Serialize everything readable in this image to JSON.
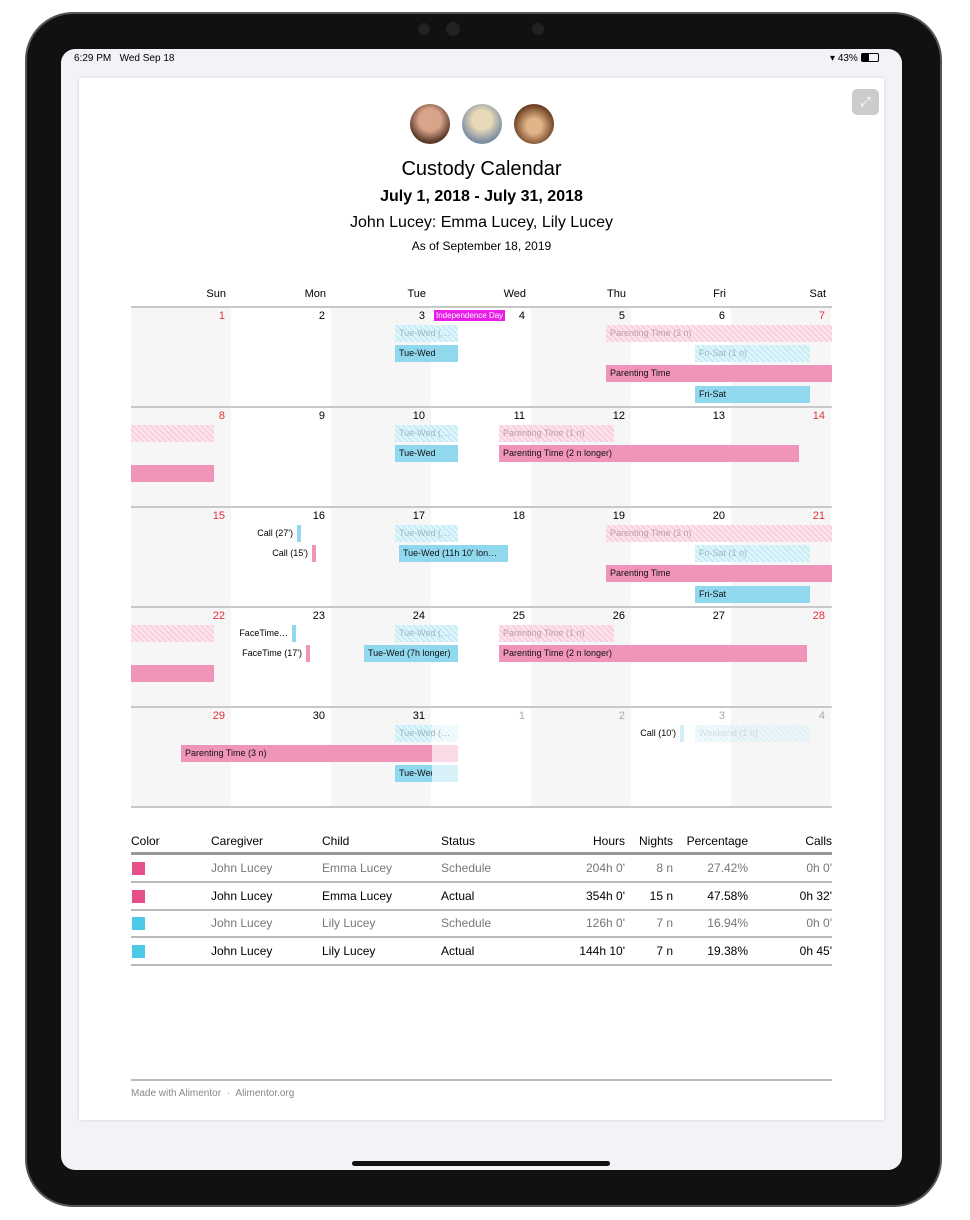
{
  "status_bar": {
    "time": "6:29 PM",
    "date": "Wed Sep 18",
    "battery": "43%"
  },
  "header": {
    "title": "Custody Calendar",
    "date_range": "July 1, 2018 - July 31, 2018",
    "family": "John Lucey: Emma Lucey, Lily Lucey",
    "as_of": "As of September 18, 2019"
  },
  "colors": {
    "parent_pink": "#f095b9",
    "child_blue": "#8fd8ee",
    "holiday": "#e81ee8",
    "weekend_red": "#e0333b",
    "swatch_pink": "#e6508a",
    "swatch_blue": "#4dc8e6"
  },
  "calendar": {
    "days": [
      "Sun",
      "Mon",
      "Tue",
      "Wed",
      "Thu",
      "Fri",
      "Sat"
    ],
    "weeks": [
      {
        "dates": [
          "1",
          "2",
          "3",
          "4",
          "5",
          "6",
          "7"
        ],
        "events": [
          "Independence Day",
          "Tue-Wed (…",
          "Tue-Wed",
          "Parenting Time (3 n)",
          "Fri-Sat (1 n)",
          "Parenting Time",
          "Fri-Sat"
        ]
      },
      {
        "dates": [
          "8",
          "9",
          "10",
          "11",
          "12",
          "13",
          "14"
        ],
        "events": [
          "Tue-Wed (…",
          "Tue-Wed",
          "Parenting Time (1 n)",
          "Parenting Time (2 n longer)"
        ]
      },
      {
        "dates": [
          "15",
          "16",
          "17",
          "18",
          "19",
          "20",
          "21"
        ],
        "events": [
          "Call (27')",
          "Call (15')",
          "Tue-Wed (…",
          "Tue-Wed (11h 10' lon…",
          "Parenting Time (3 n)",
          "Fri-Sat (1 n)",
          "Parenting Time",
          "Fri-Sat"
        ]
      },
      {
        "dates": [
          "22",
          "23",
          "24",
          "25",
          "26",
          "27",
          "28"
        ],
        "events": [
          "FaceTime…",
          "FaceTime (17')",
          "Tue-Wed (…",
          "Tue-Wed (7h longer)",
          "Parenting Time (1 n)",
          "Parenting Time (2 n longer)"
        ]
      },
      {
        "dates": [
          "29",
          "30",
          "31",
          "1",
          "2",
          "3",
          "4"
        ],
        "events": [
          "Tue-Wed (…",
          "Parenting Time (3 n)",
          "Tue-Wed",
          "Call (10')",
          "Weekend (1 n)"
        ]
      }
    ]
  },
  "summary": {
    "headers": [
      "Color",
      "Caregiver",
      "Child",
      "Status",
      "Hours",
      "Nights",
      "Percentage",
      "Calls"
    ],
    "rows": [
      {
        "color": "pink",
        "caregiver": "John Lucey",
        "child": "Emma Lucey",
        "status": "Schedule",
        "hours": "204h 0'",
        "nights": "8 n",
        "percentage": "27.42%",
        "calls": "0h 0'"
      },
      {
        "color": "pink",
        "caregiver": "John Lucey",
        "child": "Emma Lucey",
        "status": "Actual",
        "hours": "354h 0'",
        "nights": "15 n",
        "percentage": "47.58%",
        "calls": "0h 32'"
      },
      {
        "color": "blue",
        "caregiver": "John Lucey",
        "child": "Lily Lucey",
        "status": "Schedule",
        "hours": "126h 0'",
        "nights": "7 n",
        "percentage": "16.94%",
        "calls": "0h 0'"
      },
      {
        "color": "blue",
        "caregiver": "John Lucey",
        "child": "Lily Lucey",
        "status": "Actual",
        "hours": "144h 10'",
        "nights": "7 n",
        "percentage": "19.38%",
        "calls": "0h 45'"
      }
    ]
  },
  "footer": {
    "made_with": "Made with Alimentor",
    "separator": "·",
    "link": "Alimentor.org"
  }
}
